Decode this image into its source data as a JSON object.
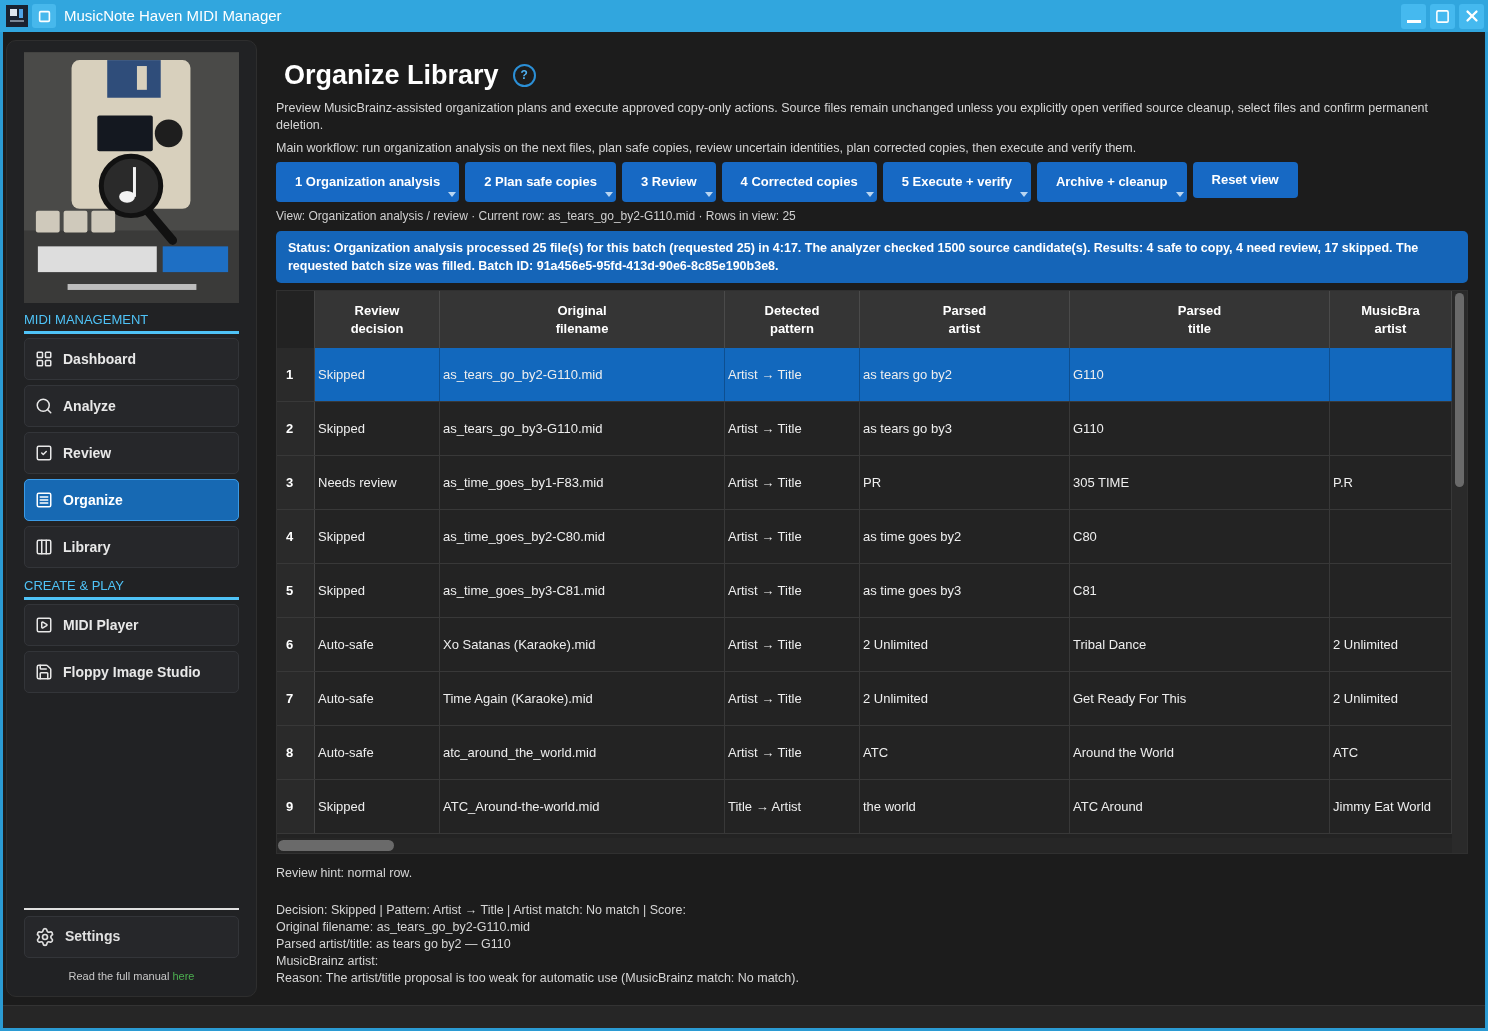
{
  "window": {
    "title": "MusicNote Haven MIDI Manager"
  },
  "sidebar": {
    "sections": [
      {
        "title": "MIDI MANAGEMENT",
        "items": [
          {
            "label": "Dashboard",
            "selected": false
          },
          {
            "label": "Analyze",
            "selected": false
          },
          {
            "label": "Review",
            "selected": false
          },
          {
            "label": "Organize",
            "selected": true
          },
          {
            "label": "Library",
            "selected": false
          }
        ]
      },
      {
        "title": "CREATE & PLAY",
        "items": [
          {
            "label": "MIDI Player",
            "selected": false
          },
          {
            "label": "Floppy Image Studio",
            "selected": false
          }
        ]
      }
    ],
    "settings": {
      "label": "Settings",
      "selected": false
    },
    "manual": {
      "text": "Read the full manual ",
      "link": "here"
    }
  },
  "page": {
    "title": "Organize Library",
    "help": "?",
    "description": "Preview MusicBrainz-assisted organization plans and execute approved copy-only actions. Source files remain unchanged unless you explicitly open verified source cleanup, select files and confirm permanent deletion.",
    "workflow": "Main workflow: run organization analysis on the next files, plan safe copies, review uncertain identities, plan corrected copies, then execute and verify them.",
    "buttons": [
      {
        "label": "1 Organization analysis",
        "kind": "menu"
      },
      {
        "label": "2 Plan safe copies",
        "kind": "menu"
      },
      {
        "label": "3 Review",
        "kind": "menu"
      },
      {
        "label": "4 Corrected copies",
        "kind": "menu"
      },
      {
        "label": "5 Execute + verify",
        "kind": "menu"
      },
      {
        "label": "Archive + cleanup",
        "kind": "menu"
      },
      {
        "label": "Reset view",
        "kind": "plain"
      }
    ],
    "view_info": "View: Organization analysis / review · Current row: as_tears_go_by2-G110.mid · Rows in view: 25",
    "status": "Status: Organization analysis processed 25 file(s) for this batch (requested 25) in 4:17. The analyzer checked 1500 source candidate(s). Results: 4 safe to copy, 4 need review, 17 skipped. The requested batch size was filled. Batch ID: 91a456e5-95fd-413d-90e6-8c85e190b3e8."
  },
  "table": {
    "columns": [
      "Review decision",
      "Original filename",
      "Detected pattern",
      "Parsed artist",
      "Parsed title",
      "MusicBra artist"
    ],
    "rows": [
      {
        "number": "1",
        "cells": [
          "Skipped",
          "as_tears_go_by2-G110.mid",
          "Artist → Title",
          "as tears go by2",
          "G110",
          ""
        ],
        "selected": true
      },
      {
        "number": "2",
        "cells": [
          "Skipped",
          "as_tears_go_by3-G110.mid",
          "Artist → Title",
          "as tears go by3",
          "G110",
          ""
        ],
        "selected": false
      },
      {
        "number": "3",
        "cells": [
          "Needs review",
          "as_time_goes_by1-F83.mid",
          "Artist → Title",
          "PR",
          "305 TIME",
          "P.R"
        ],
        "selected": false
      },
      {
        "number": "4",
        "cells": [
          "Skipped",
          "as_time_goes_by2-C80.mid",
          "Artist → Title",
          "as time goes by2",
          "C80",
          ""
        ],
        "selected": false
      },
      {
        "number": "5",
        "cells": [
          "Skipped",
          "as_time_goes_by3-C81.mid",
          "Artist → Title",
          "as time goes by3",
          "C81",
          ""
        ],
        "selected": false
      },
      {
        "number": "6",
        "cells": [
          "Auto-safe",
          "Xo Satanas (Karaoke).mid",
          "Artist → Title",
          "2 Unlimited",
          "Tribal Dance",
          "2 Unlimited"
        ],
        "selected": false
      },
      {
        "number": "7",
        "cells": [
          "Auto-safe",
          "Time Again (Karaoke).mid",
          "Artist → Title",
          "2 Unlimited",
          "Get Ready For This",
          "2 Unlimited"
        ],
        "selected": false
      },
      {
        "number": "8",
        "cells": [
          "Auto-safe",
          "atc_around_the_world.mid",
          "Artist → Title",
          "ATC",
          "Around the World",
          "ATC"
        ],
        "selected": false
      },
      {
        "number": "9",
        "cells": [
          "Skipped",
          "ATC_Around-the-world.mid",
          "Title → Artist",
          "the world",
          "ATC Around",
          "Jimmy Eat World"
        ],
        "selected": false
      }
    ]
  },
  "details": {
    "hint": "Review hint: normal row.",
    "lines": [
      "Decision: Skipped | Pattern: Artist → Title | Artist match: No match | Score:",
      "Original filename: as_tears_go_by2-G110.mid",
      "Parsed artist/title: as tears go by2 — G110",
      "MusicBrainz artist:",
      "Reason: The artist/title proposal is too weak for automatic use (MusicBrainz match: No match)."
    ]
  }
}
